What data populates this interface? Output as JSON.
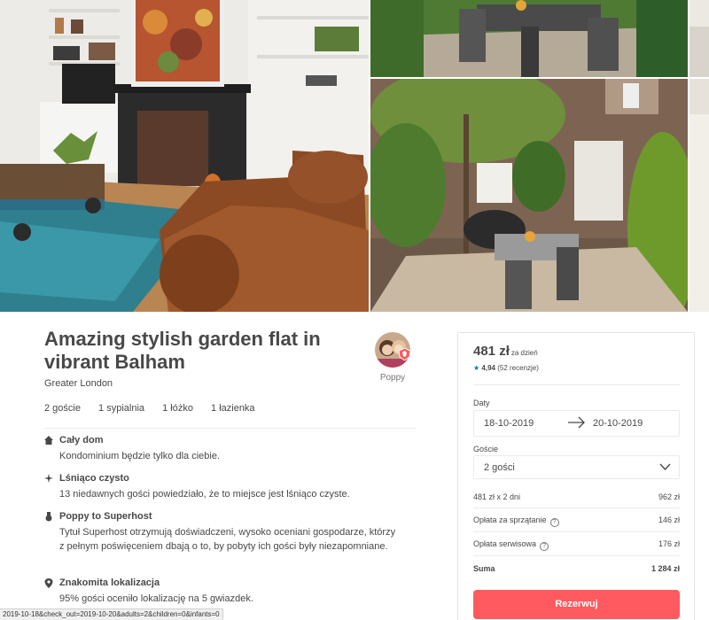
{
  "listing": {
    "title": "Amazing stylish garden flat in vibrant Balham",
    "location": "Greater London",
    "host_name": "Poppy",
    "facts": [
      "2 goście",
      "1 sypialnia",
      "1 łóżko",
      "1 łazienka"
    ]
  },
  "features": [
    {
      "icon": "home-icon",
      "title": "Cały dom",
      "desc": "Kondominium będzie tylko dla ciebie."
    },
    {
      "icon": "sparkle-icon",
      "title": "Lśniąco czysto",
      "desc": "13 niedawnych gości powiedziało, że to miejsce jest lśniąco czyste."
    },
    {
      "icon": "medal-icon",
      "title": "Poppy to Superhost",
      "desc": "Tytuł Superhost otrzymują doświadczeni, wysoko oceniani gospodarze, którzy z pełnym poświęceniem dbają o to, by pobyty ich gości były niezapomniane."
    },
    {
      "icon": "location-pin-icon",
      "title": "Znakomita lokalizacja",
      "desc": "95% gości oceniło lokalizację na 5 gwiazdek."
    }
  ],
  "booking": {
    "price": "481 zł",
    "price_unit": "za dzień",
    "rating_value": "4,94",
    "rating_count": "(52 recenzje)",
    "dates_label": "Daty",
    "check_in": "18-10-2019",
    "check_out": "20-10-2019",
    "guests_label": "Goście",
    "guests_value": "2 gości",
    "rows": [
      {
        "label": "481 zł x 2 dni",
        "value": "962 zł"
      },
      {
        "label": "Opłata za sprzątanie",
        "value": "146 zł"
      },
      {
        "label": "Opłata serwisowa",
        "value": "176 zł"
      },
      {
        "label": "Suma",
        "value": "1 284 zł"
      }
    ],
    "reserve_label": "Rezerwuj"
  },
  "statusbar": {
    "url": "2019-10-18&check_out=2019-10-20&adults=2&children=0&infants=0"
  },
  "colors": {
    "accent": "#ff5a5f",
    "rating_star": "#008489",
    "text": "#484848"
  }
}
